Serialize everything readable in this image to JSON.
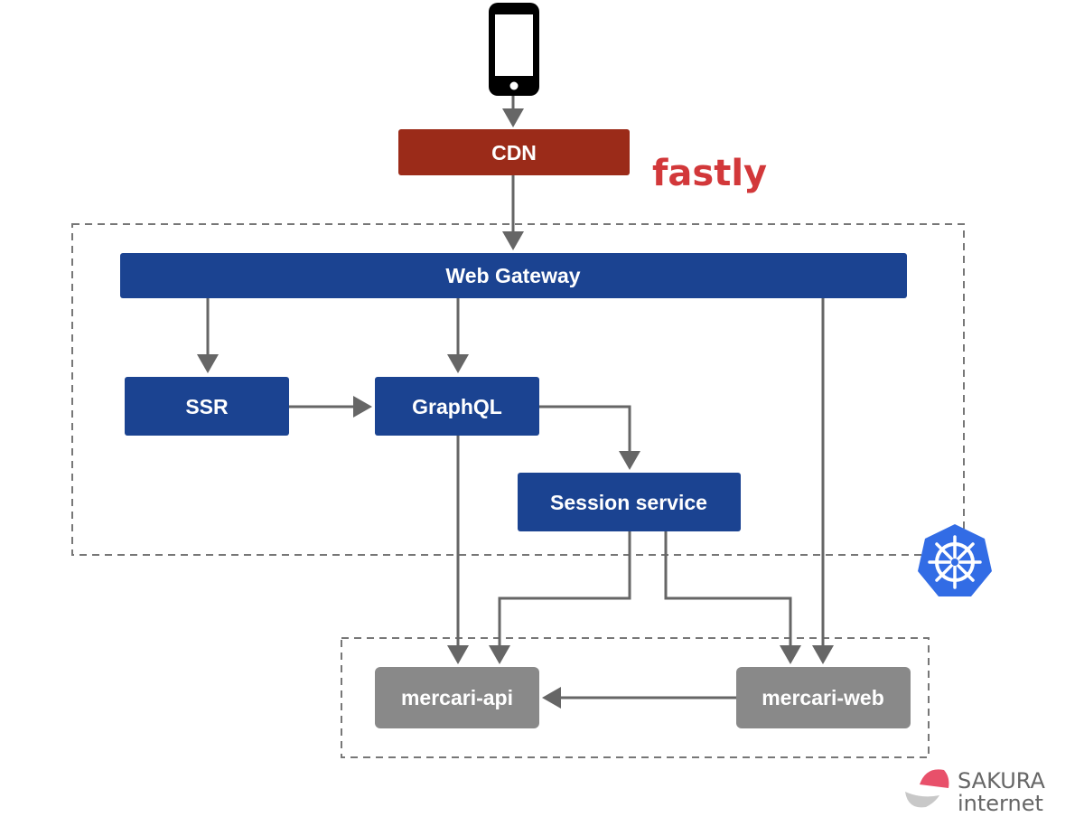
{
  "nodes": {
    "cdn": "CDN",
    "web_gateway": "Web Gateway",
    "ssr": "SSR",
    "graphql": "GraphQL",
    "session_service": "Session service",
    "mercari_api": "mercari-api",
    "mercari_web": "mercari-web"
  },
  "logos": {
    "fastly": "fastly",
    "sakura_line1": "SAKURA",
    "sakura_line2": "internet",
    "kubernetes": "kubernetes-icon",
    "client": "smartphone-icon"
  },
  "colors": {
    "cdn": "#9b2b19",
    "service": "#1b4391",
    "backend": "#898989",
    "fastly": "#d2383a",
    "kubernetes": "#326ce5"
  },
  "edges": [
    [
      "client",
      "cdn"
    ],
    [
      "cdn",
      "web_gateway"
    ],
    [
      "web_gateway",
      "ssr"
    ],
    [
      "web_gateway",
      "graphql"
    ],
    [
      "web_gateway",
      "mercari_web"
    ],
    [
      "ssr",
      "graphql"
    ],
    [
      "graphql",
      "session_service"
    ],
    [
      "graphql",
      "mercari_api"
    ],
    [
      "session_service",
      "mercari_api"
    ],
    [
      "session_service",
      "mercari_web"
    ],
    [
      "mercari_web",
      "mercari_api"
    ]
  ]
}
